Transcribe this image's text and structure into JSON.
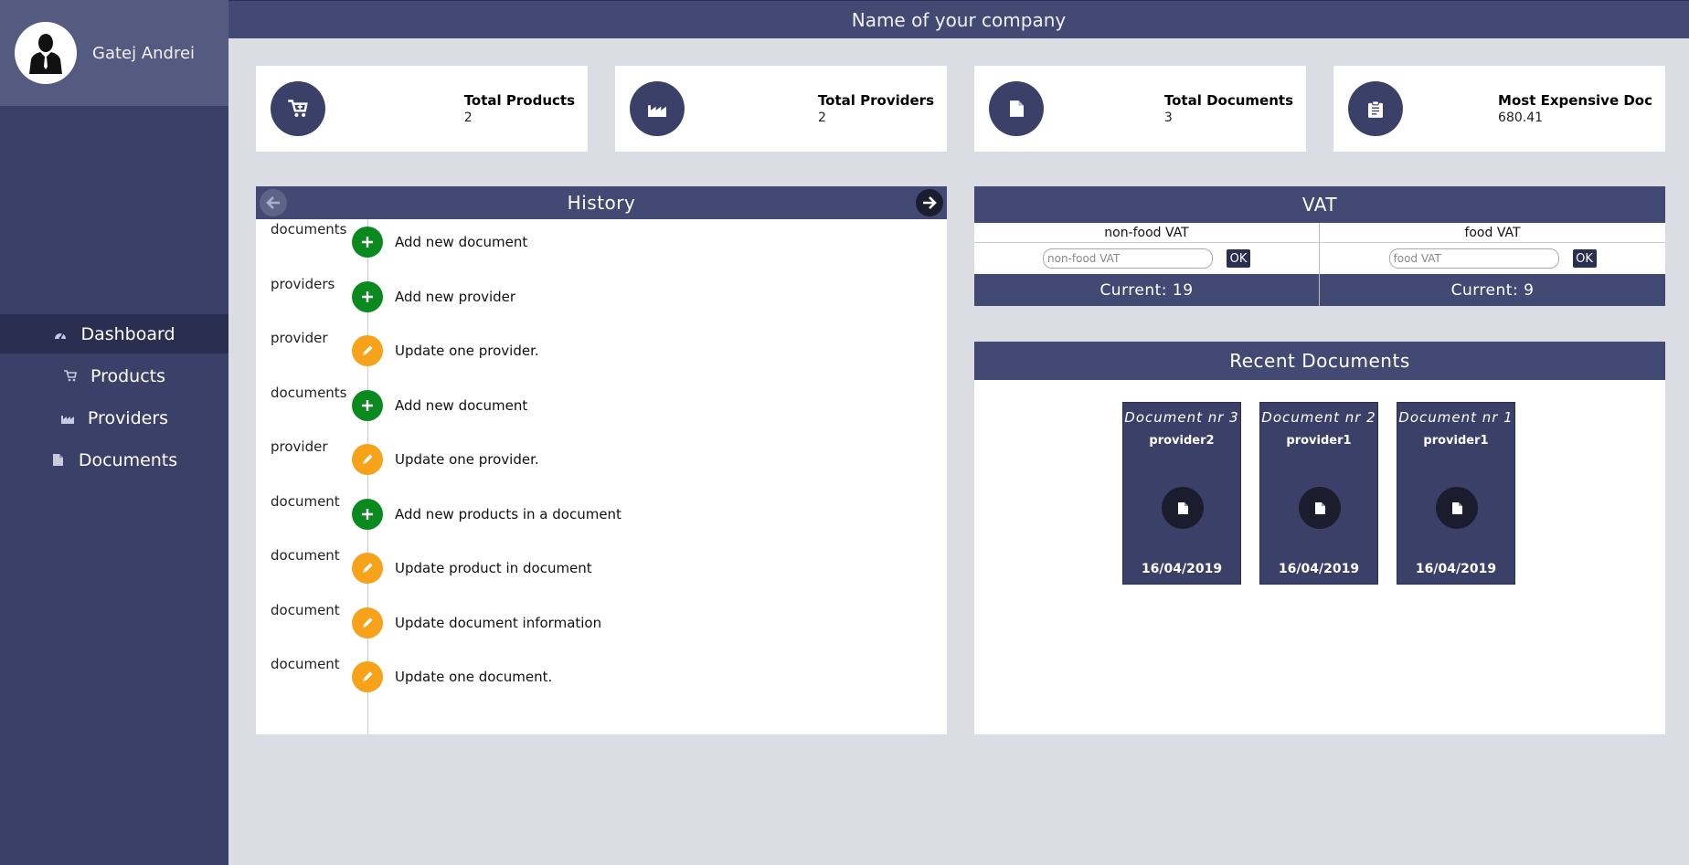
{
  "header": {
    "company": "Name of your company"
  },
  "profile": {
    "name": "Gatej Andrei"
  },
  "nav": [
    {
      "label": "Dashboard",
      "icon": "dashboard-icon",
      "active": true
    },
    {
      "label": "Products",
      "icon": "cart-icon",
      "active": false
    },
    {
      "label": "Providers",
      "icon": "factory-icon",
      "active": false
    },
    {
      "label": "Documents",
      "icon": "document-icon",
      "active": false
    }
  ],
  "stats": [
    {
      "label": "Total Products",
      "value": "2",
      "icon": "cart-icon"
    },
    {
      "label": "Total Providers",
      "value": "2",
      "icon": "factory-icon"
    },
    {
      "label": "Total Documents",
      "value": "3",
      "icon": "document-icon"
    },
    {
      "label": "Most Expensive Doc",
      "value": "680.41",
      "icon": "clipboard-icon"
    }
  ],
  "history": {
    "title": "History",
    "items": [
      {
        "entity": "documents",
        "type": "add",
        "message": "Add new document"
      },
      {
        "entity": "providers",
        "type": "add",
        "message": "Add new provider"
      },
      {
        "entity": "provider",
        "type": "update",
        "message": "Update one provider."
      },
      {
        "entity": "documents",
        "type": "add",
        "message": "Add new document"
      },
      {
        "entity": "provider",
        "type": "update",
        "message": "Update one provider."
      },
      {
        "entity": "document",
        "type": "add",
        "message": "Add new products in a document"
      },
      {
        "entity": "document",
        "type": "update",
        "message": "Update product in document"
      },
      {
        "entity": "document",
        "type": "update",
        "message": "Update document information"
      },
      {
        "entity": "document",
        "type": "update",
        "message": "Update one document."
      }
    ]
  },
  "vat": {
    "title": "VAT",
    "nonfood": {
      "label": "non-food VAT",
      "placeholder": "non-food VAT",
      "button": "OK",
      "current": "Current: 19"
    },
    "food": {
      "label": "food VAT",
      "placeholder": "food VAT",
      "button": "OK",
      "current": "Current: 9"
    }
  },
  "recent": {
    "title": "Recent Documents",
    "docs": [
      {
        "title": "Document nr 3",
        "provider": "provider2",
        "date": "16/04/2019"
      },
      {
        "title": "Document nr 2",
        "provider": "provider1",
        "date": "16/04/2019"
      },
      {
        "title": "Document nr 1",
        "provider": "provider1",
        "date": "16/04/2019"
      }
    ]
  },
  "colors": {
    "sidebar": "#3a4068",
    "header": "#424a74",
    "add": "#0a8a1e",
    "update": "#f7a21a",
    "background": "#dcdce4"
  }
}
